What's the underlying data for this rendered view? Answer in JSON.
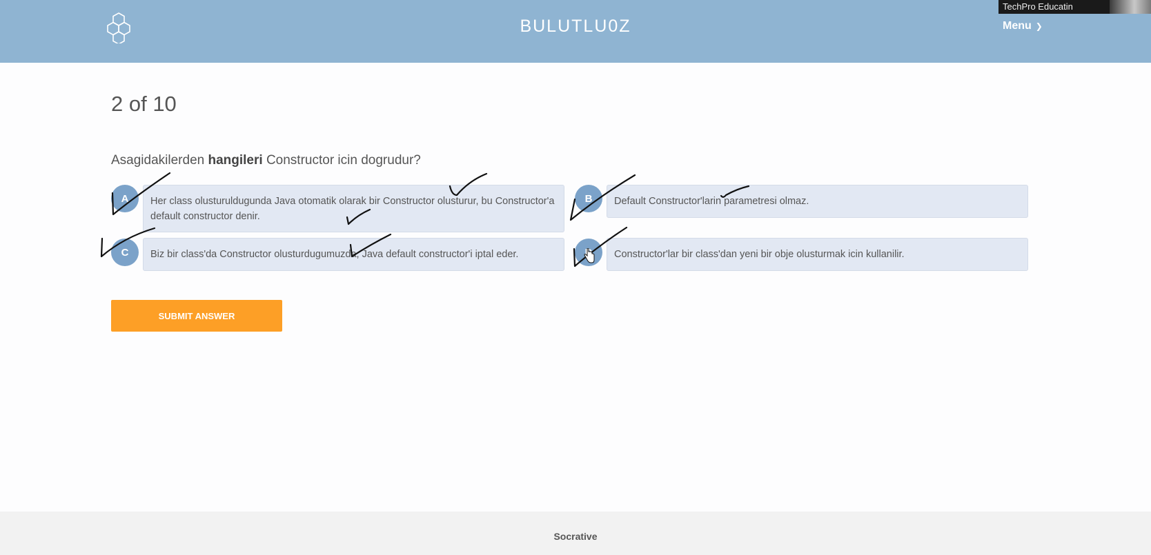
{
  "header": {
    "brand": "BULUTLU0Z",
    "menu_label": "Menu",
    "logo_icon": "hexagon-cluster-icon",
    "background_color": "#8fb4d2"
  },
  "webcam_overlay": {
    "label": "TechPro Educatin"
  },
  "quiz": {
    "progress": "2 of 10",
    "question_pre": "Asagidakilerden ",
    "question_bold": "hangileri",
    "question_post": " Constructor icin dogrudur?",
    "answers": [
      {
        "letter": "A",
        "text": "Her class olusturuldugunda Java otomatik olarak bir Constructor olusturur, bu Constructor'a default constructor denir."
      },
      {
        "letter": "B",
        "text": "Default Constructor'larin parametresi olmaz."
      },
      {
        "letter": "C",
        "text": "Biz bir class'da Constructor olusturdugumuzda, Java default constructor'i iptal eder."
      },
      {
        "letter": "D",
        "text": "Constructor'lar bir class'dan yeni bir obje olusturmak icin kullanilir."
      }
    ],
    "submit_label": "SUBMIT ANSWER",
    "accent_color": "#fd9f26",
    "choice_circle_color": "#7ba2c9"
  },
  "footer": {
    "label": "Socrative"
  }
}
